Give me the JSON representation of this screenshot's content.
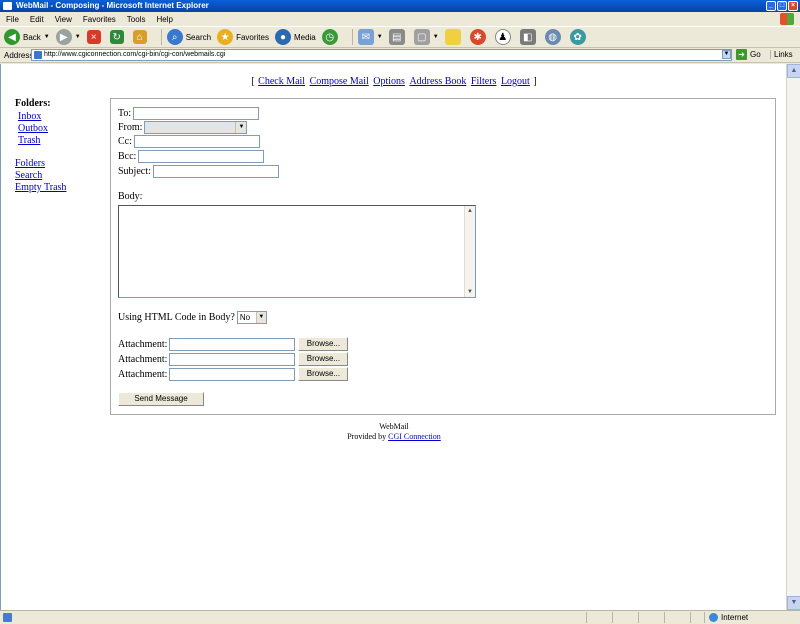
{
  "window": {
    "title": "WebMail - Composing - Microsoft Internet Explorer",
    "minimize": "_",
    "maximize": "□",
    "close": "×"
  },
  "menu": [
    "File",
    "Edit",
    "View",
    "Favorites",
    "Tools",
    "Help"
  ],
  "toolbar": {
    "back": "Back",
    "search": "Search",
    "favorites": "Favorites",
    "media": "Media"
  },
  "addressbar": {
    "label": "Address",
    "url": "http://www.cgiconnection.com/cgi-bin/cgi-con/webmails.cgi",
    "go": "Go",
    "links": "Links"
  },
  "nav": {
    "open": "[",
    "close": "]",
    "links": [
      "Check Mail",
      "Compose Mail",
      "Options",
      "Address Book",
      "Filters",
      "Logout"
    ]
  },
  "sidebar": {
    "heading": "Folders:",
    "folders": [
      "Inbox",
      "Outbox",
      "Trash"
    ],
    "actions": [
      "Folders",
      "Search",
      "Empty Trash"
    ]
  },
  "compose": {
    "to_label": "To:",
    "from_label": "From:",
    "cc_label": "Cc:",
    "bcc_label": "Bcc:",
    "subject_label": "Subject:",
    "body_label": "Body:",
    "html_label": "Using HTML Code in Body?",
    "html_value": "No",
    "attachment_label": "Attachment:",
    "browse_label": "Browse...",
    "send_label": "Send Message"
  },
  "footer": {
    "line1": "WebMail",
    "provided_by": "Provided by",
    "provider": "CGI Connection"
  },
  "statusbar": {
    "zone": "Internet"
  }
}
